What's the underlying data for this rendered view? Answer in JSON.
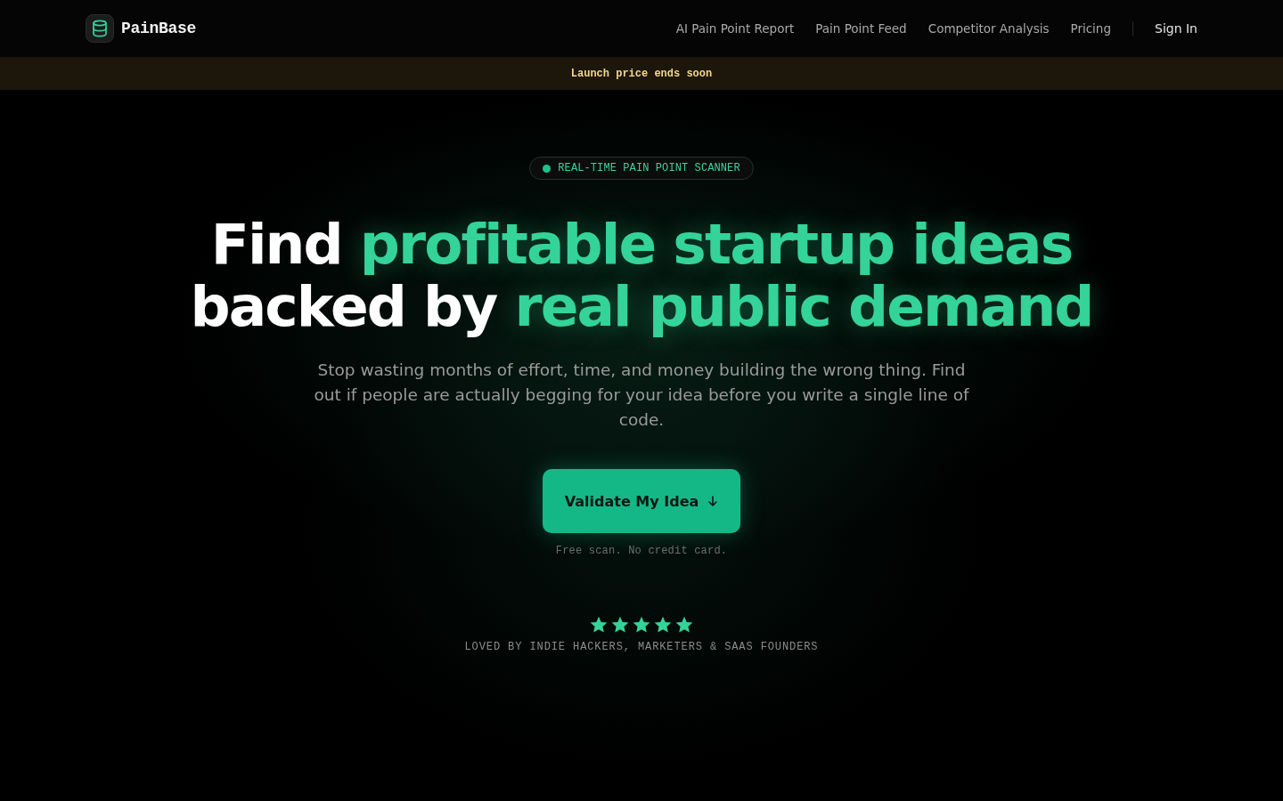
{
  "header": {
    "logo_text": "PainBase",
    "nav": [
      "AI Pain Point Report",
      "Pain Point Feed",
      "Competitor Analysis",
      "Pricing"
    ],
    "sign_in": "Sign In"
  },
  "banner": {
    "text": "Launch price ends soon"
  },
  "hero": {
    "badge": "REAL-TIME PAIN POINT SCANNER",
    "headline": {
      "lines": [
        [
          {
            "text": "Find",
            "accent": false
          },
          {
            "text": "profitable startup ideas",
            "accent": true
          }
        ],
        [
          {
            "text": "backed by",
            "accent": false
          },
          {
            "text": "real public demand",
            "accent": true
          }
        ]
      ]
    },
    "subtitle": "Stop wasting months of effort, time, and money building the wrong thing. Find out if people are actually begging for your idea before you write a single line of code.",
    "cta": {
      "label": "Validate My Idea"
    },
    "cta_note": "Free scan. No credit card.",
    "rating": {
      "stars": 5,
      "caption": "LOVED BY INDIE HACKERS, MARKETERS & SAAS FOUNDERS"
    }
  }
}
